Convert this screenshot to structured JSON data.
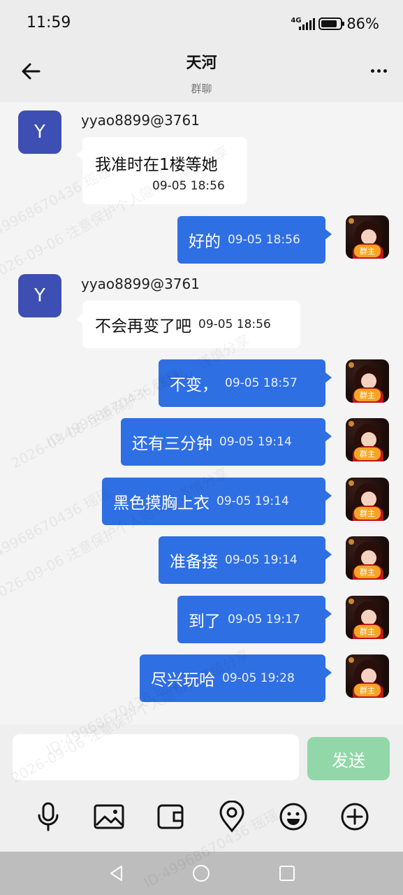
{
  "status_bar": {
    "time": "11:59",
    "network": "4G",
    "battery_percent": "86%",
    "battery_level": 0.86
  },
  "header": {
    "title": "天河",
    "subtitle": "群聊"
  },
  "badges": {
    "owner": "群主"
  },
  "messages": [
    {
      "direction": "in",
      "sender": "yyao8899@3761",
      "avatar_letter": "Y",
      "text": "我准时在1楼等她",
      "time": "09-05 18:56"
    },
    {
      "direction": "out",
      "text": "好的",
      "time": "09-05 18:56"
    },
    {
      "direction": "in",
      "sender": "yyao8899@3761",
      "avatar_letter": "Y",
      "text": "不会再变了吧",
      "time": "09-05 18:56"
    },
    {
      "direction": "out",
      "text": "不变，",
      "time": "09-05 18:57"
    },
    {
      "direction": "out",
      "text": "还有三分钟",
      "time": "09-05 19:14"
    },
    {
      "direction": "out",
      "text": "黑色摸胸上衣",
      "time": "09-05 19:14"
    },
    {
      "direction": "out",
      "text": "准备接",
      "time": "09-05 19:14"
    },
    {
      "direction": "out",
      "text": "到了",
      "time": "09-05 19:17"
    },
    {
      "direction": "out",
      "text": "尽兴玩哈",
      "time": "09-05 19:28"
    }
  ],
  "composer": {
    "placeholder": "",
    "send_label": "发送"
  },
  "toolbar_icons": [
    "microphone-icon",
    "image-icon",
    "wallet-icon",
    "location-icon",
    "emoji-icon",
    "plus-icon"
  ],
  "watermark": {
    "line1": "ID:4996867043​6 瑶瑶",
    "line2": "2026-09-06 注意保护个人隐私，谨慎分享"
  },
  "colors": {
    "outgoing_bubble": "#2f6fe4",
    "incoming_avatar": "#3d4fb2",
    "send_button": "#92d7a8",
    "owner_badge": "#f5a524"
  }
}
